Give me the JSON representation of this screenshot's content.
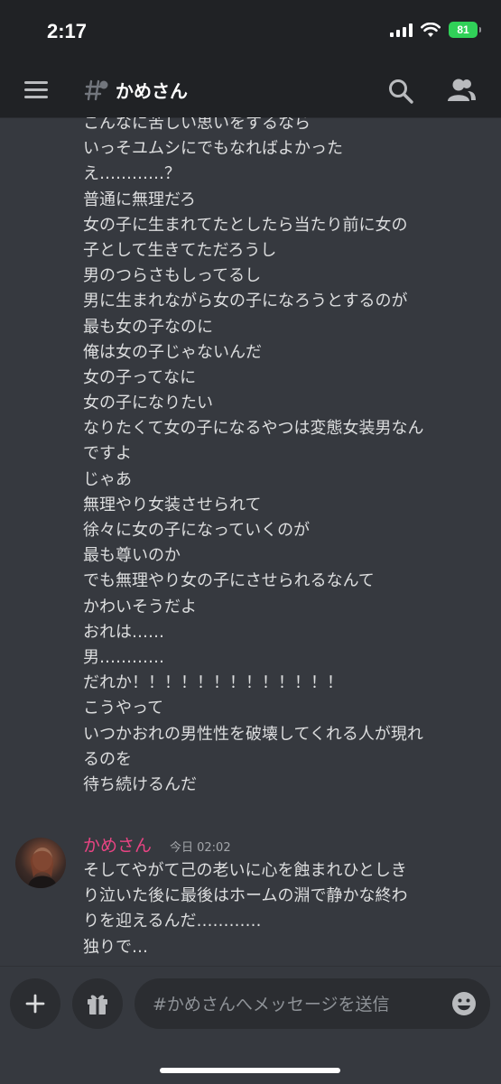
{
  "status_bar": {
    "time": "2:17",
    "battery": "81"
  },
  "header": {
    "channel_name": "かめさん"
  },
  "messages": {
    "continuation_lines": [
      "こんなに苦しい思いをするなら",
      "いっそユムシにでもなればよかった",
      "え…………？",
      "普通に無理だろ",
      "女の子に生まれてたとしたら当たり前に女の",
      "子として生きてただろうし",
      "男のつらさもしってるし",
      "男に生まれながら女の子になろうとするのが",
      "最も女の子なのに",
      "俺は女の子じゃないんだ",
      "女の子ってなに",
      "女の子になりたい",
      "なりたくて女の子になるやつは変態女装男なん",
      "ですよ",
      "じゃあ",
      "無理やり女装させられて",
      "徐々に女の子になっていくのが",
      "最も尊いのか",
      "でも無理やり女の子にさせられるなんて",
      "かわいそうだよ",
      "おれは……",
      "男…………",
      "だれか！！！！！！！！！！！！！",
      "こうやって",
      "いつかおれの男性性を破壊してくれる人が現れ",
      "るのを",
      "待ち続けるんだ"
    ],
    "group": {
      "username": "かめさん",
      "timestamp": "今日 02:02",
      "lines": [
        "そしてやがて己の老いに心を蝕まれひとしき",
        "り泣いた後に最後はホームの淵で静かな終わ",
        "りを迎えるんだ…………",
        "独りで…"
      ]
    }
  },
  "composer": {
    "placeholder": "#かめさんへメッセージを送信"
  },
  "colors": {
    "background": "#36393f",
    "header": "#202225",
    "username": "#e94483",
    "battery": "#30d158"
  }
}
